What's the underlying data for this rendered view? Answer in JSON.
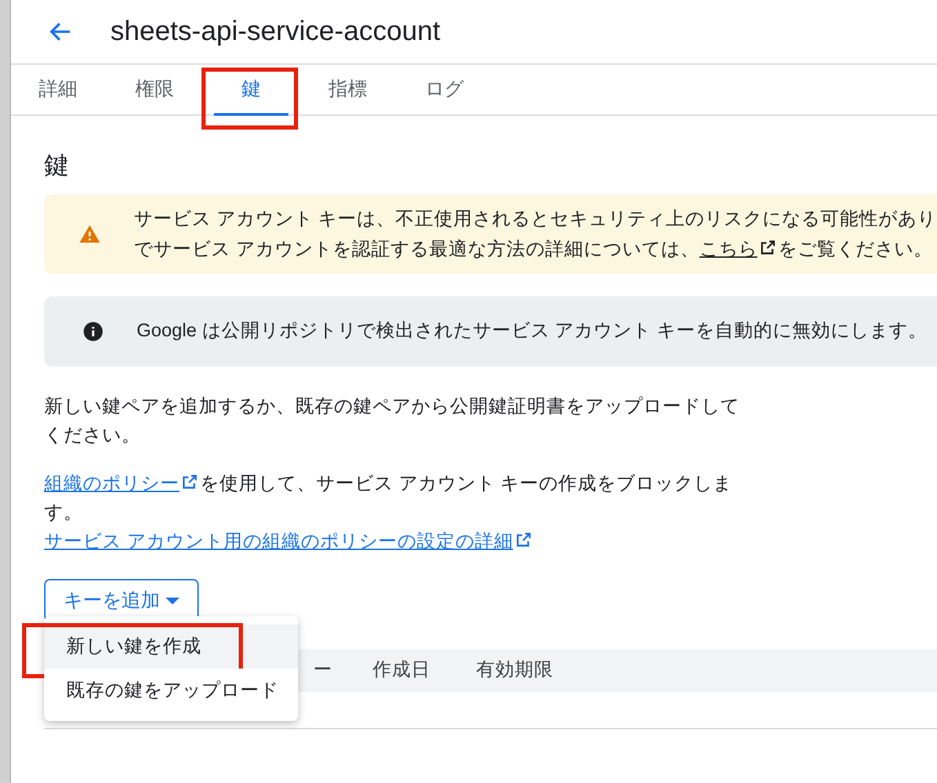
{
  "header": {
    "title": "sheets-api-service-account"
  },
  "tabs": [
    {
      "label": "詳細",
      "selected": false,
      "highlighted": false
    },
    {
      "label": "権限",
      "selected": false,
      "highlighted": false
    },
    {
      "label": "鍵",
      "selected": true,
      "highlighted": true
    },
    {
      "label": "指標",
      "selected": false,
      "highlighted": false
    },
    {
      "label": "ログ",
      "selected": false,
      "highlighted": false
    }
  ],
  "heading": "鍵",
  "warning": {
    "lines": [
      {
        "text": "サービス アカウント キーは、不正使用されるとセキュリティ上のリスクになる可能性があり"
      },
      {
        "text": "でサービス アカウントを認証する最適な方法の詳細については、",
        "link": "こちら",
        "after": "をご覧ください。"
      }
    ]
  },
  "info": {
    "text": "Google は公開リポジトリで検出されたサービス アカウント キーを自動的に無効にします。"
  },
  "intro": "新しい鍵ペアを追加するか、既存の鍵ペアから公開鍵証明書をアップロードしてください。",
  "policy": {
    "link": "組織のポリシー",
    "text": "を使用して、サービス アカウント キーの作成をブロックします。"
  },
  "policy_details_link": "サービス アカウント用の組織のポリシーの設定の詳細",
  "add_key_button": "キーを追加",
  "table": {
    "columns": [
      "ー",
      "作成日",
      "有効期限"
    ]
  },
  "menu": {
    "items": [
      {
        "label": "新しい鍵を作成",
        "hovered": true,
        "highlighted": true
      },
      {
        "label": "既存の鍵をアップロード",
        "hovered": false,
        "highlighted": false
      }
    ]
  }
}
